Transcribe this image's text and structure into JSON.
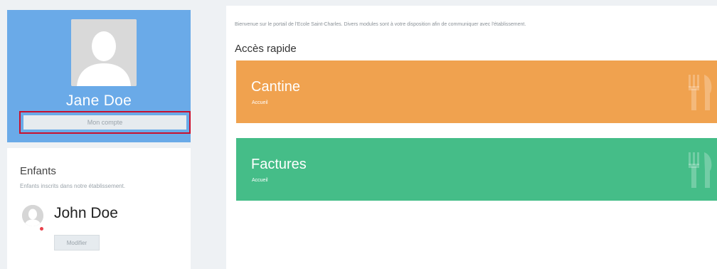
{
  "profile": {
    "name": "Jane Doe",
    "account_button": "Mon compte"
  },
  "children": {
    "title": "Enfants",
    "subtitle": "Enfants inscrits dans notre établissement.",
    "items": [
      {
        "name": "John Doe",
        "modify_button": "Modifier"
      }
    ]
  },
  "main": {
    "welcome": "Bienvenue sur le portail de l'Ecole Saint-Charles. Divers modules sont à votre disposition afin de communiquer avec l'établissement.",
    "quick_access_title": "Accès rapide",
    "tiles": [
      {
        "title": "Cantine",
        "subtitle": "Accueil",
        "color": "#f0a24f",
        "icon": "fork-knife-icon"
      },
      {
        "title": "Factures",
        "subtitle": "Accueil",
        "color": "#45bd88",
        "icon": "fork-knife-icon"
      }
    ]
  },
  "colors": {
    "profile_bg": "#6aaae8",
    "highlight_border": "#c8102e",
    "page_bg": "#eef1f4"
  }
}
